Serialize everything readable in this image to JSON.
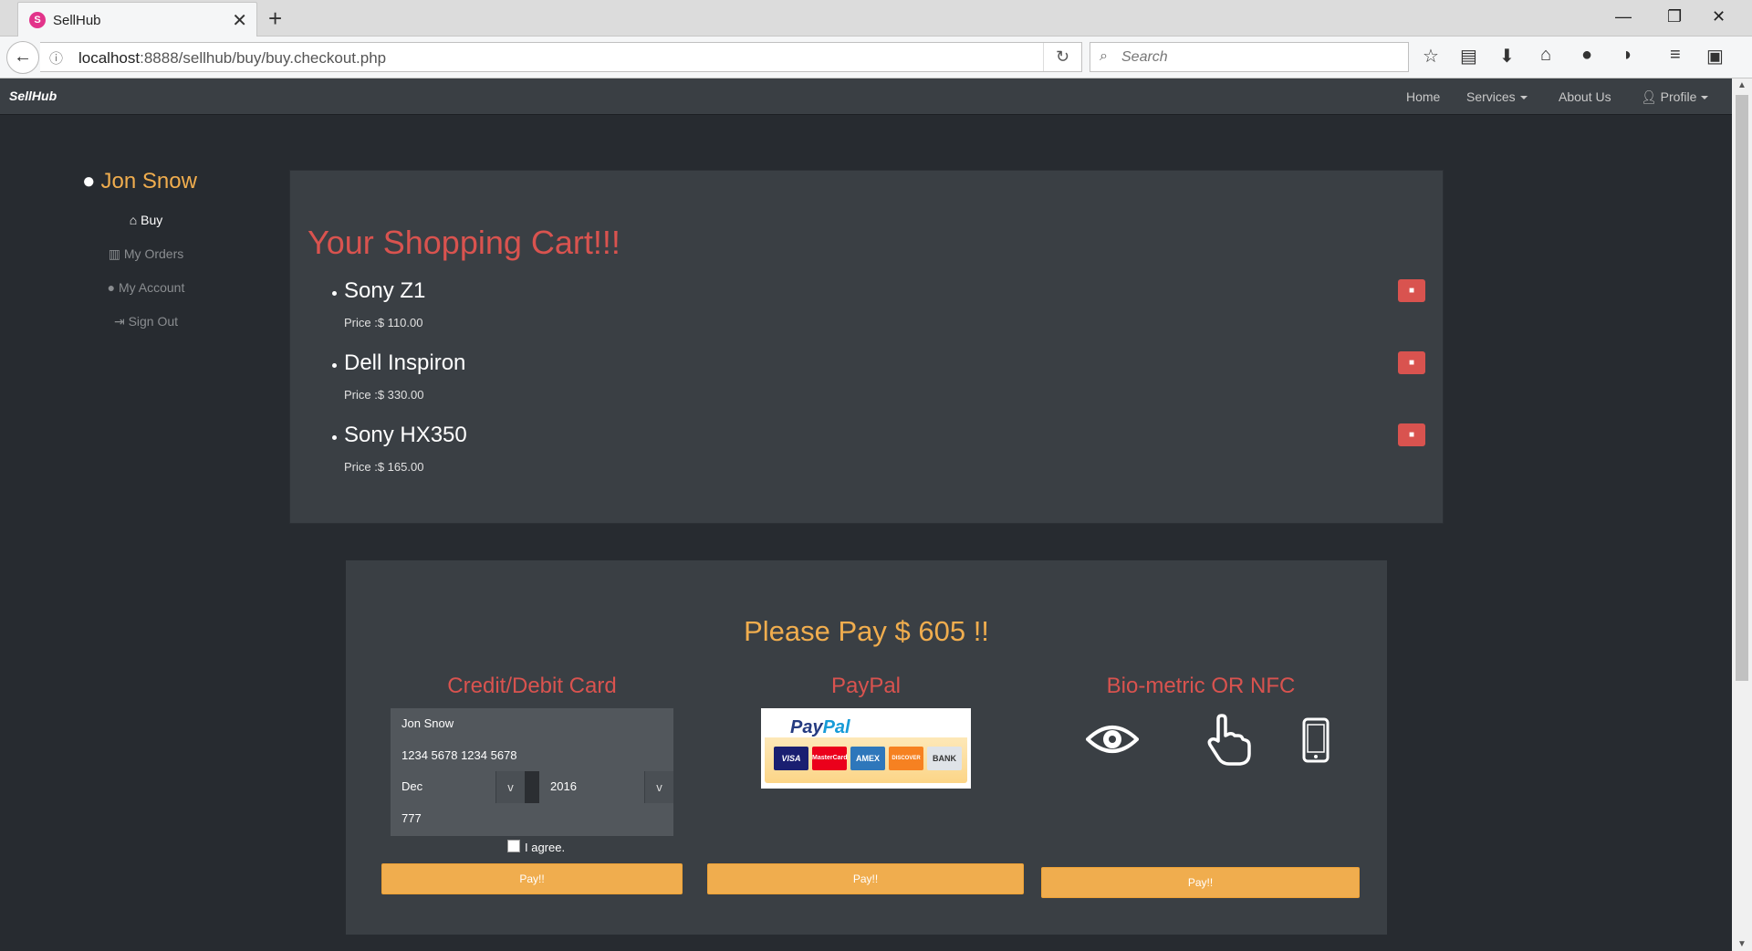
{
  "browser": {
    "tab_title": "SellHub",
    "tab_favicon_letter": "S",
    "url_host": "localhost",
    "url_rest": ":8888/sellhub/buy/buy.checkout.php",
    "search_placeholder": "Search"
  },
  "navbar": {
    "brand": "SellHub",
    "links": {
      "home": "Home",
      "services": "Services",
      "about": "About Us",
      "profile": "Profile"
    }
  },
  "sidebar": {
    "user_name": "Jon Snow",
    "items": {
      "buy": "Buy",
      "orders": "My Orders",
      "account": "My Account",
      "signout": "Sign Out"
    }
  },
  "cart": {
    "title": "Your Shopping Cart!!!",
    "items": [
      {
        "name": "Sony Z1",
        "price": "Price :$ 110.00"
      },
      {
        "name": "Dell Inspiron",
        "price": "Price :$ 330.00"
      },
      {
        "name": "Sony HX350",
        "price": "Price :$ 165.00"
      }
    ]
  },
  "payment": {
    "total": "Please Pay $ 605 !!",
    "card": {
      "title": "Credit/Debit Card",
      "name_value": "Jon Snow",
      "number_value": "1234 5678 1234 5678",
      "month_value": "Dec",
      "year_value": "2016",
      "cvv_value": "777",
      "select_arrow": "v",
      "agree_label": "I agree.",
      "button": "Pay!!"
    },
    "paypal": {
      "title": "PayPal",
      "logo_text_a": "Pay",
      "logo_text_b": "Pal",
      "cards": [
        "VISA",
        "MasterCard",
        "AMEX",
        "DISCOVER",
        "BANK"
      ],
      "button": "Pay!!"
    },
    "bio": {
      "title": "Bio-metric OR NFC",
      "icons": [
        "eye-icon",
        "touch-icon",
        "phone-icon"
      ],
      "button": "Pay!!"
    }
  },
  "colors": {
    "accent_orange": "#f0ad4e",
    "accent_red": "#d9534f",
    "background": "#272b30",
    "panel": "#3a3f44"
  }
}
